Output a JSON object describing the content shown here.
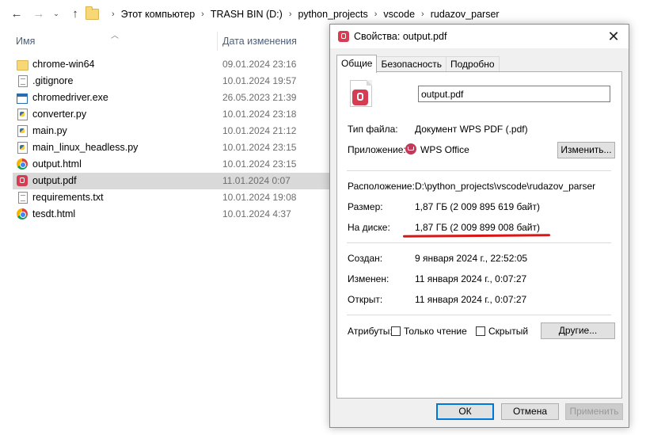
{
  "explorer": {
    "breadcrumb": [
      "Этот компьютер",
      "TRASH BIN (D:)",
      "python_projects",
      "vscode",
      "rudazov_parser"
    ],
    "columns": {
      "name": "Имя",
      "date": "Дата изменения"
    },
    "files": [
      {
        "name": "chrome-win64",
        "date": "09.01.2024 23:16",
        "icon": "folder-icon"
      },
      {
        "name": ".gitignore",
        "date": "10.01.2024 19:57",
        "icon": "text-file-icon"
      },
      {
        "name": "chromedriver.exe",
        "date": "26.05.2023 21:39",
        "icon": "exe-icon"
      },
      {
        "name": "converter.py",
        "date": "10.01.2024 23:18",
        "icon": "python-file-icon"
      },
      {
        "name": "main.py",
        "date": "10.01.2024 21:12",
        "icon": "python-file-icon"
      },
      {
        "name": "main_linux_headless.py",
        "date": "10.01.2024 23:15",
        "icon": "python-file-icon"
      },
      {
        "name": "output.html",
        "date": "10.01.2024 23:15",
        "icon": "chrome-icon"
      },
      {
        "name": "output.pdf",
        "date": "11.01.2024 0:07",
        "icon": "wps-pdf-icon",
        "selected": true
      },
      {
        "name": "requirements.txt",
        "date": "10.01.2024 19:08",
        "icon": "text-file-icon"
      },
      {
        "name": "tesdt.html",
        "date": "10.01.2024 4:37",
        "icon": "chrome-icon"
      }
    ]
  },
  "dialog": {
    "title": "Свойства: output.pdf",
    "tabs": [
      "Общие",
      "Безопасность",
      "Подробно"
    ],
    "active_tab": "Общие",
    "file_name": "output.pdf",
    "labels": {
      "file_type": "Тип файла:",
      "app": "Приложение:",
      "location": "Расположение:",
      "size": "Размер:",
      "on_disk": "На диске:",
      "created": "Создан:",
      "modified": "Изменен:",
      "accessed": "Открыт:",
      "attributes": "Атрибуты:"
    },
    "values": {
      "file_type": "Документ WPS PDF (.pdf)",
      "app": "WPS Office",
      "location": "D:\\python_projects\\vscode\\rudazov_parser",
      "size": "1,87 ГБ (2 009 895 619 байт)",
      "on_disk": "1,87 ГБ (2 009 899 008 байт)",
      "created": "9 января 2024 г., 22:52:05",
      "modified": "11 января 2024 г., 0:07:27",
      "accessed": "11 января 2024 г., 0:07:27"
    },
    "attributes": {
      "readonly": "Только чтение",
      "hidden": "Скрытый",
      "readonly_checked": false,
      "hidden_checked": false
    },
    "buttons": {
      "change": "Изменить...",
      "other": "Другие...",
      "ok": "ОК",
      "cancel": "Отмена",
      "apply": "Применить"
    },
    "annotation_color": "#d81616"
  }
}
